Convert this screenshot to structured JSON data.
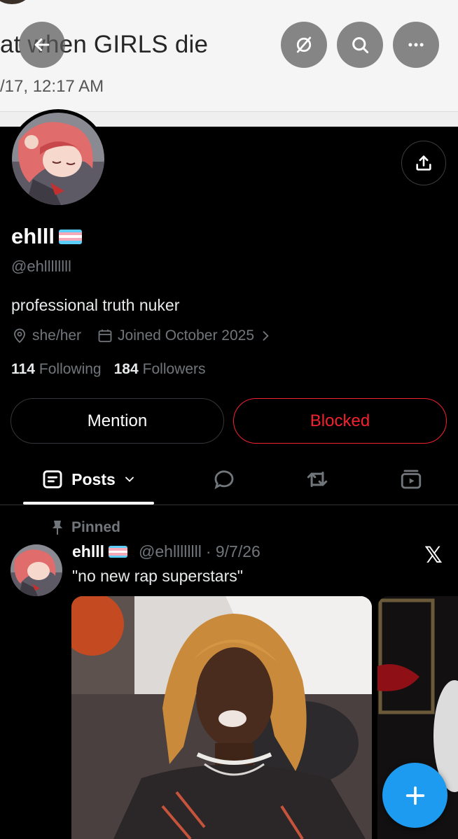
{
  "banner": {
    "title": "at when GIRLS die",
    "date": "/17, 12:17 AM"
  },
  "header": {
    "back_icon": "arrow-left-icon",
    "grok_icon": "grok-icon",
    "search_icon": "search-icon",
    "more_icon": "more-horizontal-icon"
  },
  "profile": {
    "display_name": "ehlll",
    "handle": "@ehllllllll",
    "bio": "professional truth nuker",
    "pronouns": "she/her",
    "joined": "Joined October 2025",
    "following_count": "114",
    "following_label": "Following",
    "followers_count": "184",
    "followers_label": "Followers",
    "flag_colors": [
      "#5BCEFA",
      "#F5A9B8",
      "#FFFFFF",
      "#F5A9B8",
      "#5BCEFA"
    ]
  },
  "actions": {
    "mention_label": "Mention",
    "blocked_label": "Blocked"
  },
  "tabs": {
    "posts_label": "Posts"
  },
  "post": {
    "pinned_label": "Pinned",
    "author_name": "ehlll",
    "author_handle": "@ehllllllll",
    "date": "· 9/7/26",
    "text": "\"no new rap superstars\"",
    "source_logo": "𝕏"
  },
  "colors": {
    "accent_blue": "#1d9bf0",
    "blocked_red": "#f4212e",
    "muted_gray": "#71767b"
  }
}
